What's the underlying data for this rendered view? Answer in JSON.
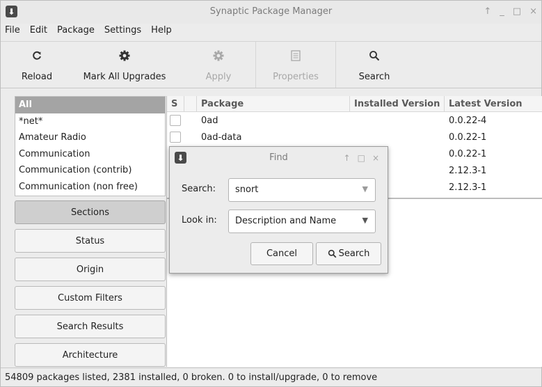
{
  "window": {
    "title": "Synaptic Package Manager",
    "app_icon": "download-arrow-icon",
    "controls": [
      "↑",
      "_",
      "□",
      "×"
    ]
  },
  "menubar": [
    "File",
    "Edit",
    "Package",
    "Settings",
    "Help"
  ],
  "toolbar": {
    "reload": {
      "label": "Reload",
      "icon": "reload-icon"
    },
    "mark_all": {
      "label": "Mark All Upgrades",
      "icon": "gear-icon"
    },
    "apply": {
      "label": "Apply",
      "icon": "gear-icon"
    },
    "properties": {
      "label": "Properties",
      "icon": "properties-icon"
    },
    "search": {
      "label": "Search",
      "icon": "search-icon"
    }
  },
  "sidebar": {
    "categories": [
      "All",
      "*net*",
      "Amateur Radio",
      "Communication",
      "Communication (contrib)",
      "Communication (non free)"
    ],
    "selected": "All",
    "filters": [
      "Sections",
      "Status",
      "Origin",
      "Custom Filters",
      "Search Results",
      "Architecture"
    ],
    "active_filter": "Sections"
  },
  "packages": {
    "columns": [
      "S",
      "Package",
      "Installed Version",
      "Latest Version"
    ],
    "rows": [
      {
        "name": "0ad",
        "installed": "",
        "latest": "0.0.22-4"
      },
      {
        "name": "0ad-data",
        "installed": "",
        "latest": "0.0.22-1"
      },
      {
        "name": "",
        "installed": "",
        "latest": "0.0.22-1"
      },
      {
        "name": "",
        "installed": "",
        "latest": "2.12.3-1"
      },
      {
        "name": "",
        "installed": "",
        "latest": "2.12.3-1"
      }
    ]
  },
  "status": "54809 packages listed, 2381 installed, 0 broken. 0 to install/upgrade, 0 to remove",
  "find_dialog": {
    "title": "Find",
    "controls": [
      "↑",
      "□",
      "×"
    ],
    "search_label": "Search:",
    "search_value": "snort",
    "lookin_label": "Look in:",
    "lookin_value": "Description and Name",
    "cancel_label": "Cancel",
    "search_button_label": "Search"
  }
}
